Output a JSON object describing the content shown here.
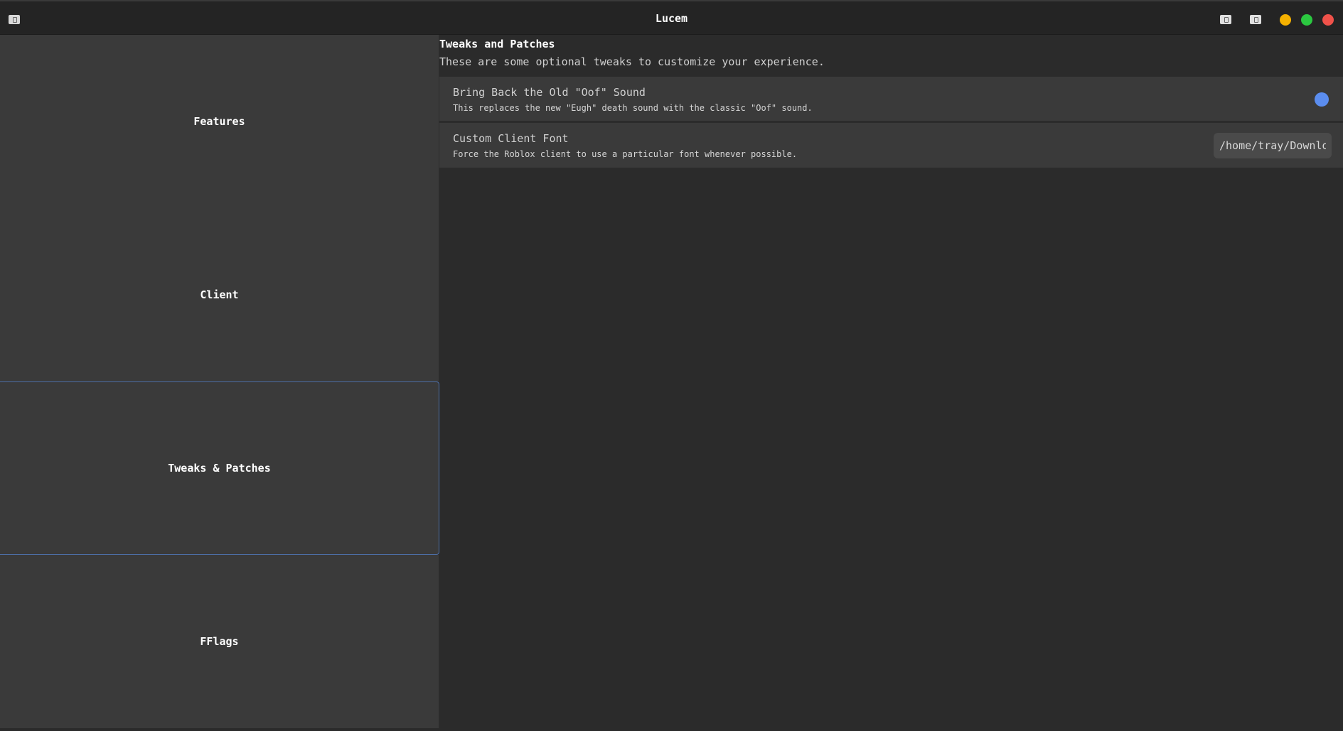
{
  "window": {
    "title": "Lucem",
    "app_icon": "app-logo-icon",
    "titlebar_icons": [
      "screenshot-icon",
      "screenshot-icon"
    ],
    "traffic_lights": {
      "minimize": "#f5b100",
      "maximize": "#2bc840",
      "close": "#f0524a"
    }
  },
  "sidebar": {
    "items": [
      {
        "label": "Features",
        "active": false
      },
      {
        "label": "Client",
        "active": false
      },
      {
        "label": "Tweaks & Patches",
        "active": true
      },
      {
        "label": "FFlags",
        "active": false
      }
    ],
    "active_border_color": "#4c6ea6"
  },
  "main": {
    "title": "Tweaks and Patches",
    "description": "These are some optional tweaks to customize your experience.",
    "settings": [
      {
        "label": "Bring Back the Old \"Oof\" Sound",
        "help": "This replaces the new \"Eugh\" death sound with the classic \"Oof\" sound.",
        "control": "toggle",
        "enabled": true,
        "accent": "#5b8def"
      },
      {
        "label": "Custom Client Font",
        "help": "Force the Roblox client to use a particular font whenever possible.",
        "control": "text-input",
        "value": "/home/tray/Downloads"
      }
    ]
  }
}
